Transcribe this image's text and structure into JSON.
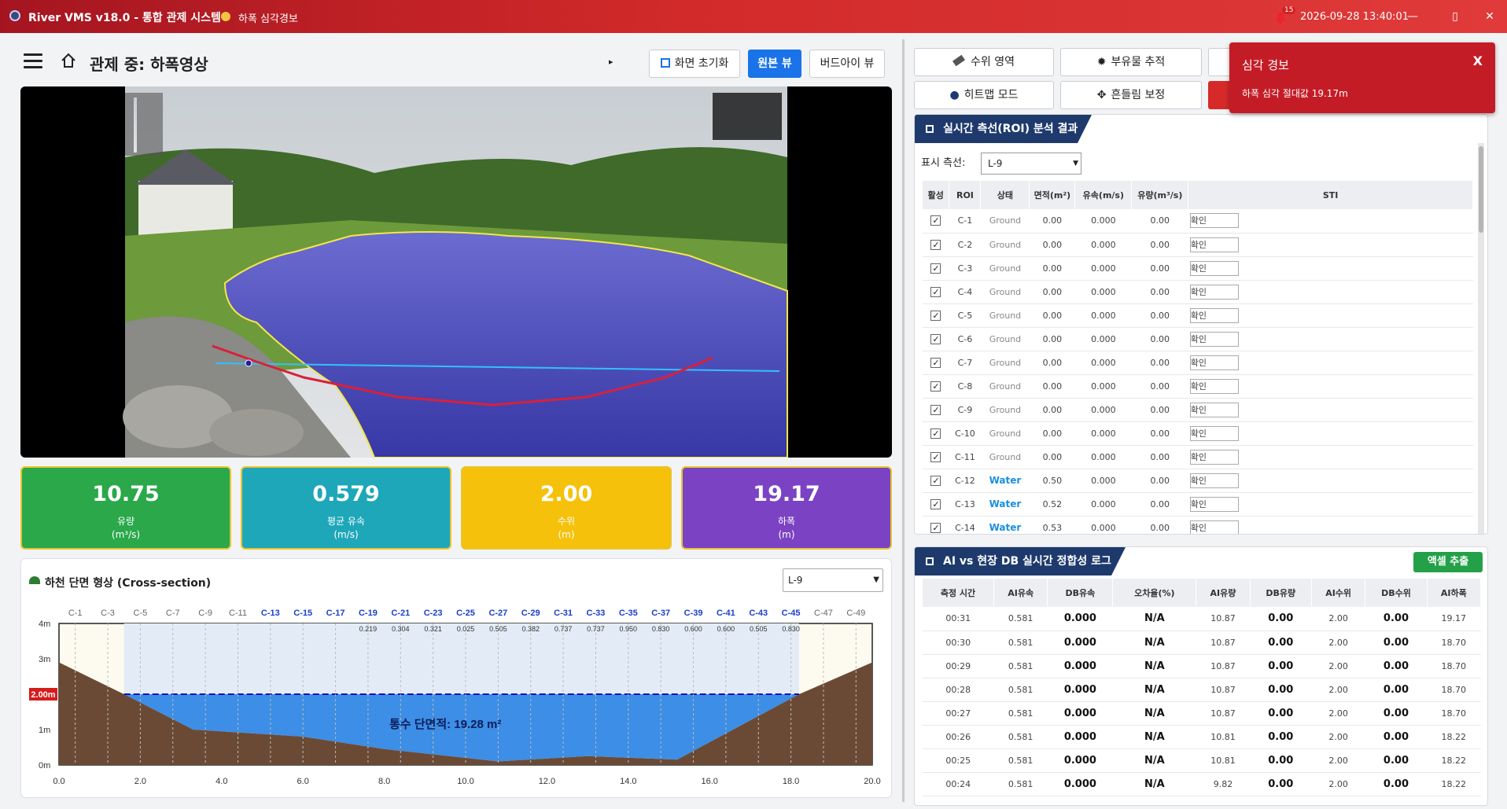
{
  "window": {
    "app_title": "River VMS v18.0 - 통합 관제 시스템",
    "alert_status": "하폭 심각경보",
    "notification_count": "15",
    "clock": "2026-09-28 13:40:01",
    "minimize": "—",
    "maximize": "▯",
    "close": "✕"
  },
  "header": {
    "title": "관제 중: 하폭영상",
    "arrow": "▸",
    "reset_label": "화면 초기화",
    "original_view_label": "원본 뷰",
    "birdseye_view_label": "버드아이 뷰"
  },
  "metrics": [
    {
      "value": "10.75",
      "label": "유량",
      "unit": "(m³/s)",
      "color": "#2aa84a"
    },
    {
      "value": "0.579",
      "label": "평균 유속",
      "unit": "(m/s)",
      "color": "#1ea7b8"
    },
    {
      "value": "2.00",
      "label": "수위",
      "unit": "(m)",
      "color": "#f6c10a"
    },
    {
      "value": "19.17",
      "label": "하폭",
      "unit": "(m)",
      "color": "#7b42c3"
    }
  ],
  "cross_section": {
    "title": "하천 단면 형상 (Cross-section)",
    "selected": "L-9",
    "area_label": "통수 단면적: 19.28 m²",
    "water_level_label": "2.00m",
    "x_ticks": [
      "0.0",
      "2.0",
      "4.0",
      "6.0",
      "8.0",
      "10.0",
      "12.0",
      "14.0",
      "16.0",
      "18.0",
      "20.0"
    ],
    "y_ticks": [
      "4m",
      "3m",
      "2m",
      "1m",
      "0m"
    ],
    "columns": [
      "C-1",
      "C-3",
      "C-5",
      "C-7",
      "C-9",
      "C-11",
      "C-13",
      "C-15",
      "C-17",
      "C-19",
      "C-21",
      "C-23",
      "C-25",
      "C-27",
      "C-29",
      "C-31",
      "C-33",
      "C-35",
      "C-37",
      "C-39",
      "C-41",
      "C-43",
      "C-45",
      "C-47",
      "C-49"
    ],
    "velocities": [
      "",
      "",
      "",
      "",
      "",
      "",
      "",
      "",
      "",
      "0.219",
      "0.304",
      "0.321",
      "0.025",
      "0.505",
      "0.382",
      "0.737",
      "0.737",
      "0.950",
      "0.830",
      "0.600",
      "0.600",
      "0.505",
      "0.830",
      "",
      ""
    ]
  },
  "tools": {
    "water_area": "수위 영역",
    "float_track": "부유물 추적",
    "heatmap": "히트맵 모드",
    "shake_correct": "흔들림 보정"
  },
  "roi_panel": {
    "title": "실시간 측선(ROI) 분석 결과",
    "line_label": "표시 측선:",
    "line_value": "L-9",
    "headers": [
      "활성",
      "ROI",
      "상태",
      "면적(m²)",
      "유속(m/s)",
      "유량(m³/s)",
      "STI"
    ],
    "confirm_label": "확인",
    "rows": [
      {
        "roi": "C-1",
        "state": "Ground",
        "area": "0.00",
        "vel": "0.000",
        "flow": "0.00"
      },
      {
        "roi": "C-2",
        "state": "Ground",
        "area": "0.00",
        "vel": "0.000",
        "flow": "0.00"
      },
      {
        "roi": "C-3",
        "state": "Ground",
        "area": "0.00",
        "vel": "0.000",
        "flow": "0.00"
      },
      {
        "roi": "C-4",
        "state": "Ground",
        "area": "0.00",
        "vel": "0.000",
        "flow": "0.00"
      },
      {
        "roi": "C-5",
        "state": "Ground",
        "area": "0.00",
        "vel": "0.000",
        "flow": "0.00"
      },
      {
        "roi": "C-6",
        "state": "Ground",
        "area": "0.00",
        "vel": "0.000",
        "flow": "0.00"
      },
      {
        "roi": "C-7",
        "state": "Ground",
        "area": "0.00",
        "vel": "0.000",
        "flow": "0.00"
      },
      {
        "roi": "C-8",
        "state": "Ground",
        "area": "0.00",
        "vel": "0.000",
        "flow": "0.00"
      },
      {
        "roi": "C-9",
        "state": "Ground",
        "area": "0.00",
        "vel": "0.000",
        "flow": "0.00"
      },
      {
        "roi": "C-10",
        "state": "Ground",
        "area": "0.00",
        "vel": "0.000",
        "flow": "0.00"
      },
      {
        "roi": "C-11",
        "state": "Ground",
        "area": "0.00",
        "vel": "0.000",
        "flow": "0.00"
      },
      {
        "roi": "C-12",
        "state": "Water",
        "area": "0.50",
        "vel": "0.000",
        "flow": "0.00"
      },
      {
        "roi": "C-13",
        "state": "Water",
        "area": "0.52",
        "vel": "0.000",
        "flow": "0.00"
      },
      {
        "roi": "C-14",
        "state": "Water",
        "area": "0.53",
        "vel": "0.000",
        "flow": "0.00"
      }
    ]
  },
  "log_panel": {
    "title": "AI vs 현장 DB 실시간 정합성 로그",
    "export_label": "액셀 추출",
    "headers": [
      "측정 시간",
      "AI유속",
      "DB유속",
      "오차율(%)",
      "AI유량",
      "DB유량",
      "AI수위",
      "DB수위",
      "AI하폭"
    ],
    "rows": [
      [
        "00:31",
        "0.581",
        "0.000",
        "N/A",
        "10.87",
        "0.00",
        "2.00",
        "0.00",
        "19.17"
      ],
      [
        "00:30",
        "0.581",
        "0.000",
        "N/A",
        "10.87",
        "0.00",
        "2.00",
        "0.00",
        "18.70"
      ],
      [
        "00:29",
        "0.581",
        "0.000",
        "N/A",
        "10.87",
        "0.00",
        "2.00",
        "0.00",
        "18.70"
      ],
      [
        "00:28",
        "0.581",
        "0.000",
        "N/A",
        "10.87",
        "0.00",
        "2.00",
        "0.00",
        "18.70"
      ],
      [
        "00:27",
        "0.581",
        "0.000",
        "N/A",
        "10.87",
        "0.00",
        "2.00",
        "0.00",
        "18.70"
      ],
      [
        "00:26",
        "0.581",
        "0.000",
        "N/A",
        "10.81",
        "0.00",
        "2.00",
        "0.00",
        "18.22"
      ],
      [
        "00:25",
        "0.581",
        "0.000",
        "N/A",
        "10.81",
        "0.00",
        "2.00",
        "0.00",
        "18.22"
      ],
      [
        "00:24",
        "0.581",
        "0.000",
        "N/A",
        "9.82",
        "0.00",
        "2.00",
        "0.00",
        "18.22"
      ]
    ]
  },
  "toast": {
    "title": "심각 경보",
    "close": "X",
    "message": "하폭 심각 절대값 19.17m"
  }
}
